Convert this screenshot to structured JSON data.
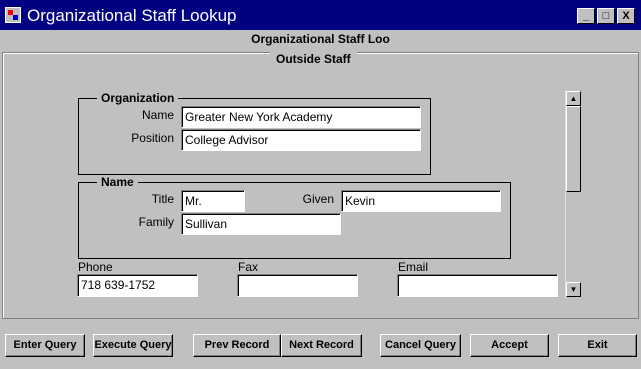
{
  "window": {
    "title": "Organizational Staff Lookup",
    "icon": "app-icon",
    "controls": {
      "minimize": "_",
      "maximize": "□",
      "close": "X"
    }
  },
  "subtitle": "Organizational Staff Loo",
  "panel": {
    "legend": "Outside Staff"
  },
  "organization": {
    "legend": "Organization",
    "name_label": "Name",
    "name_value": "Greater New York Academy",
    "position_label": "Position",
    "position_value": "College Advisor"
  },
  "name_group": {
    "legend": "Name",
    "title_label": "Title",
    "title_value": "Mr.",
    "given_label": "Given",
    "given_value": "Kevin",
    "family_label": "Family",
    "family_value": "Sullivan"
  },
  "contact": {
    "phone_label": "Phone",
    "phone_value": "718 639-1752",
    "fax_label": "Fax",
    "fax_value": "",
    "email_label": "Email",
    "email_value": ""
  },
  "scrollbar": {
    "up": "▲",
    "down": "▼"
  },
  "buttons": {
    "enter_query": "Enter Query",
    "execute_query": "Execute Query",
    "prev_record": "Prev Record",
    "next_record": "Next Record",
    "cancel_query": "Cancel Query",
    "accept": "Accept",
    "exit": "Exit"
  }
}
